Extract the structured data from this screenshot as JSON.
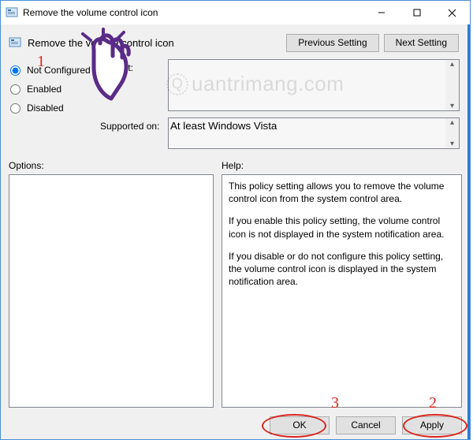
{
  "titlebar": {
    "icon_name": "policy-icon",
    "title": "Remove the volume control icon"
  },
  "header": {
    "icon_name": "policy-icon",
    "title": "Remove the volume control icon",
    "prev_label": "Previous Setting",
    "next_label": "Next Setting"
  },
  "radios": {
    "not_configured": "Not Configured",
    "enabled": "Enabled",
    "disabled": "Disabled",
    "selected": "not_configured"
  },
  "comment": {
    "label_suffix": "ent:",
    "value": ""
  },
  "supported": {
    "label": "Supported on:",
    "value": "At least Windows Vista"
  },
  "options": {
    "label": "Options:"
  },
  "help": {
    "label": "Help:",
    "paragraphs": [
      "This policy setting allows you to remove the volume control icon from the system control area.",
      "If you enable this policy setting, the volume control icon is not displayed in the system notification area.",
      "If you disable or do not configure this policy setting, the volume control icon is displayed in the system notification area."
    ]
  },
  "footer": {
    "ok": "OK",
    "cancel": "Cancel",
    "apply": "Apply"
  },
  "annotations": {
    "a1": "1",
    "a2": "2",
    "a3": "3"
  },
  "watermark": "uantrimang.com"
}
